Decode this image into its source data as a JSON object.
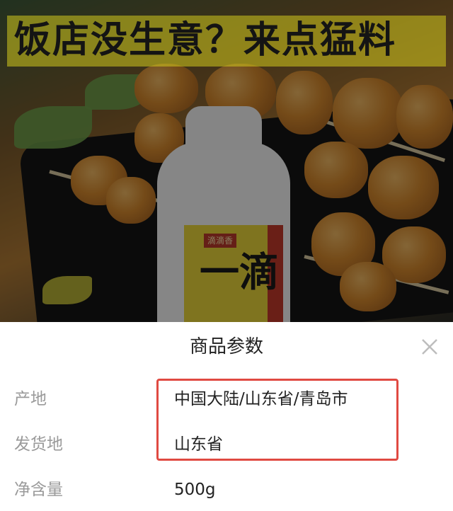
{
  "banner": {
    "text": "饭店没生意？来点猛料"
  },
  "product": {
    "brand_badge": "滴滴香",
    "big_text": "一滴"
  },
  "sheet": {
    "title": "商品参数",
    "close_icon": "close-icon",
    "params": [
      {
        "label": "产地",
        "value": "中国大陆/山东省/青岛市"
      },
      {
        "label": "发货地",
        "value": "山东省"
      },
      {
        "label": "净含量",
        "value": "500g"
      }
    ]
  },
  "colors": {
    "highlight": "#e04a42",
    "label_gray": "#9a9a9a"
  }
}
